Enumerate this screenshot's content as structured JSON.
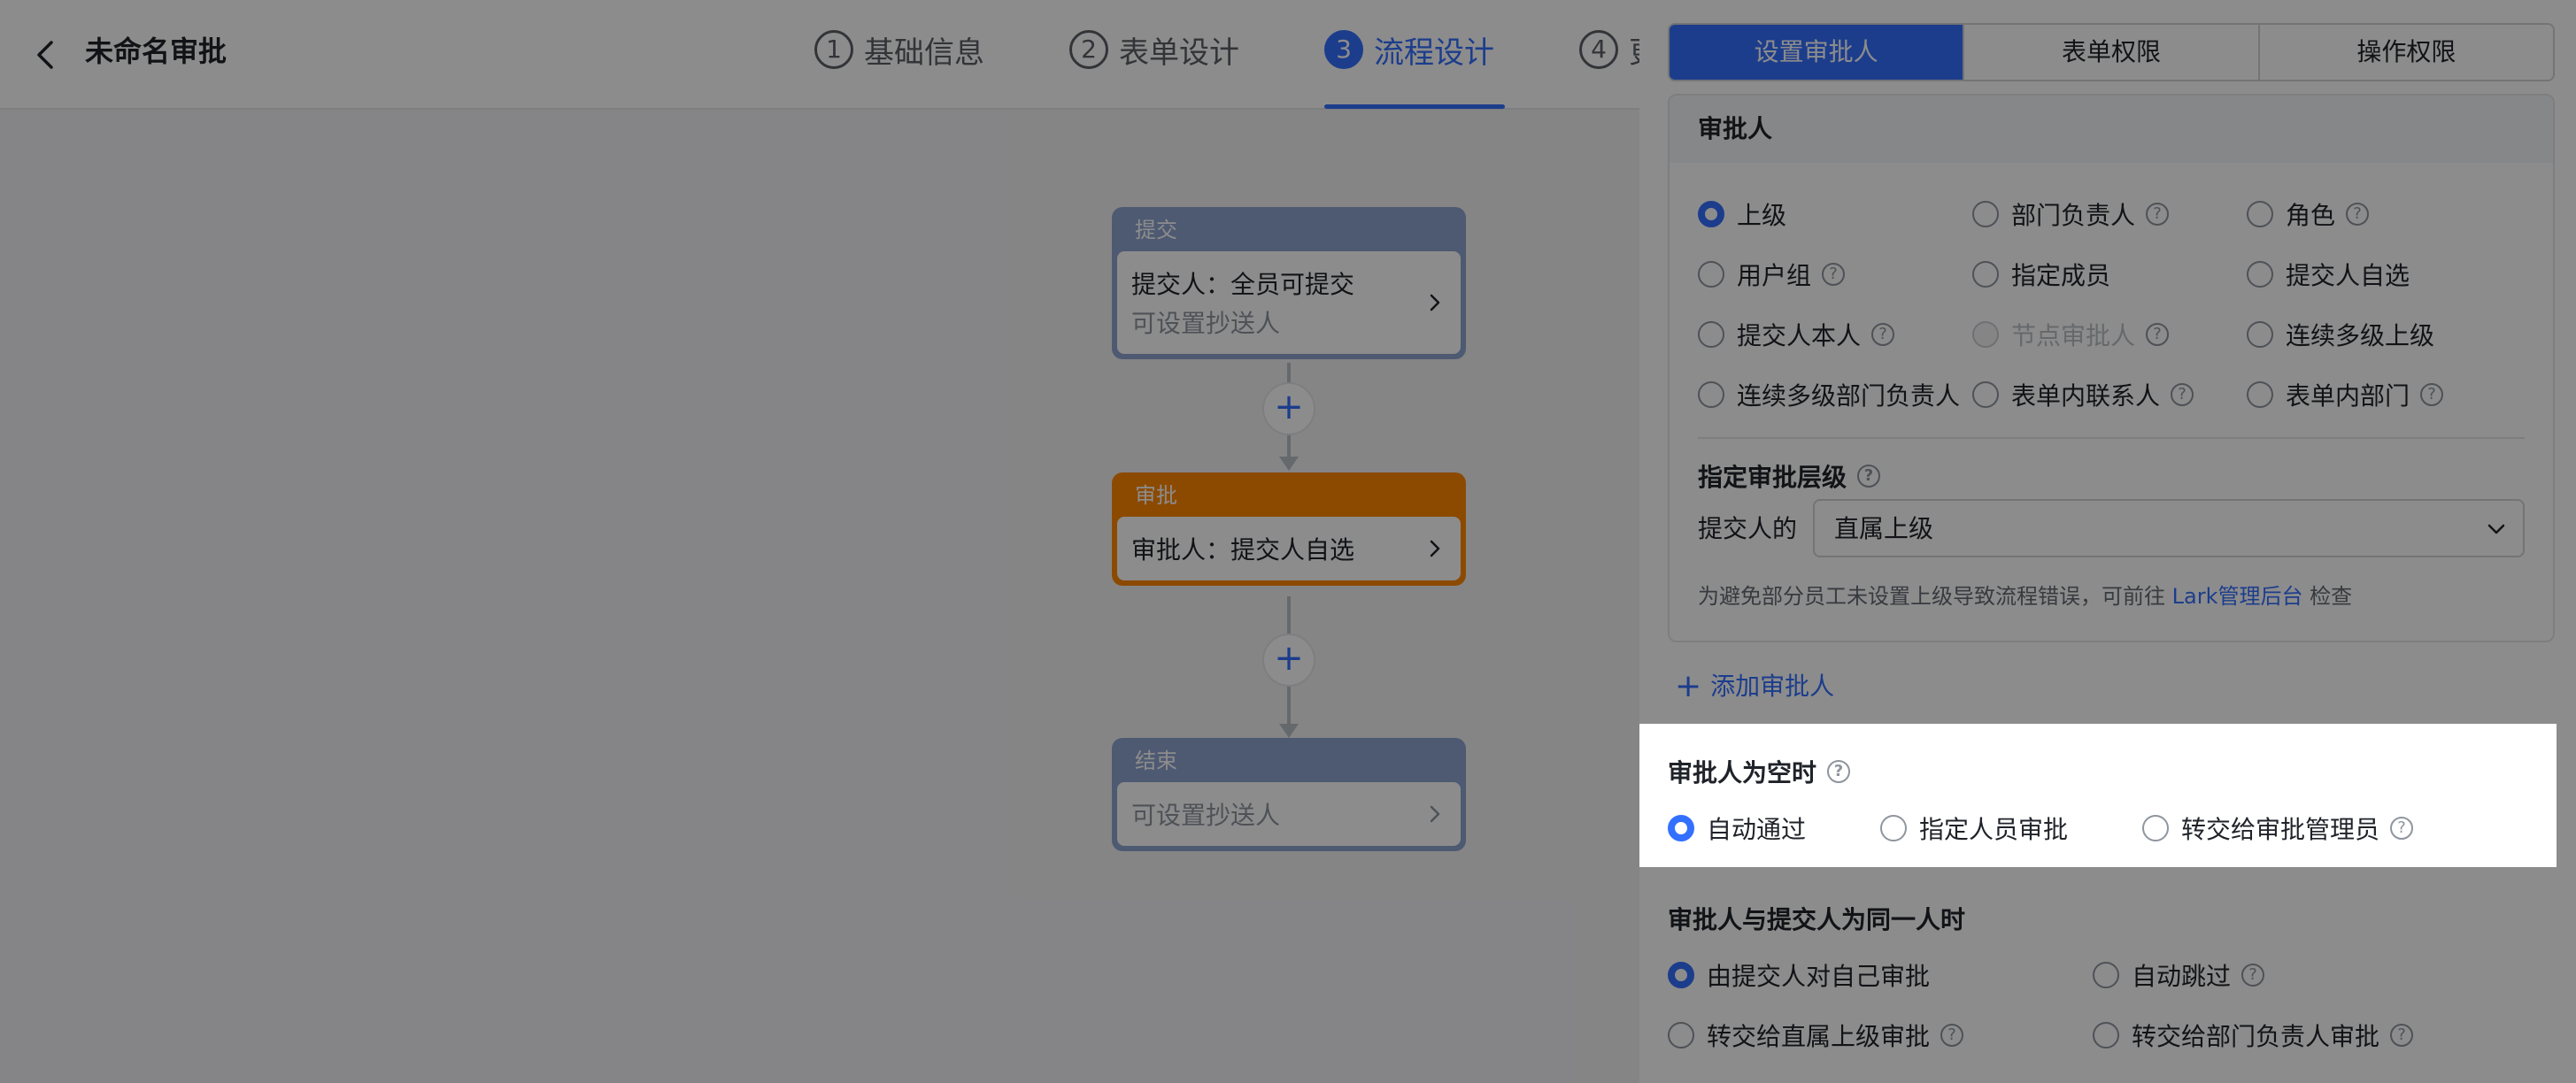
{
  "header": {
    "title": "未命名审批",
    "steps": [
      {
        "num": "1",
        "label": "基础信息"
      },
      {
        "num": "2",
        "label": "表单设计"
      },
      {
        "num": "3",
        "label": "流程设计"
      },
      {
        "num": "4",
        "label": "更"
      }
    ]
  },
  "flow": {
    "submit": {
      "title": "提交",
      "line1": "提交人：全员可提交",
      "line2": "可设置抄送人"
    },
    "approve": {
      "title": "审批",
      "line1": "审批人：提交人自选"
    },
    "end": {
      "title": "结束",
      "line1": "可设置抄送人"
    },
    "plus": "+"
  },
  "panel": {
    "tabs": [
      "设置审批人",
      "表单权限",
      "操作权限"
    ],
    "approver_card": {
      "title": "审批人",
      "options": [
        "上级",
        "部门负责人",
        "角色",
        "用户组",
        "指定成员",
        "提交人自选",
        "提交人本人",
        "节点审批人",
        "连续多级上级",
        "连续多级部门负责人",
        "表单内联系人",
        "表单内部门"
      ],
      "selected": "上级",
      "disabled": [
        "节点审批人"
      ],
      "level_label": "指定审批层级",
      "level_prefix": "提交人的",
      "level_value": "直属上级",
      "hint_text": "为避免部分员工未设置上级导致流程错误，可前往 ",
      "hint_link": "Lark管理后台",
      "hint_suffix": " 检查"
    },
    "add_approver": "添加审批人",
    "empty_section": {
      "title": "审批人为空时",
      "options": [
        "自动通过",
        "指定人员审批",
        "转交给审批管理员"
      ],
      "selected": "自动通过"
    },
    "same_person_section": {
      "title": "审批人与提交人为同一人时",
      "options": [
        "由提交人对自己审批",
        "自动跳过",
        "转交给直属上级审批",
        "转交给部门负责人审批"
      ],
      "selected": "由提交人对自己审批"
    },
    "help_glyph": "?"
  },
  "colors": {
    "accent": "#3370ff",
    "approve_node": "#ff8800",
    "submit_node": "#8ea3cf",
    "overlay": "rgba(0,0,0,0.45)"
  }
}
